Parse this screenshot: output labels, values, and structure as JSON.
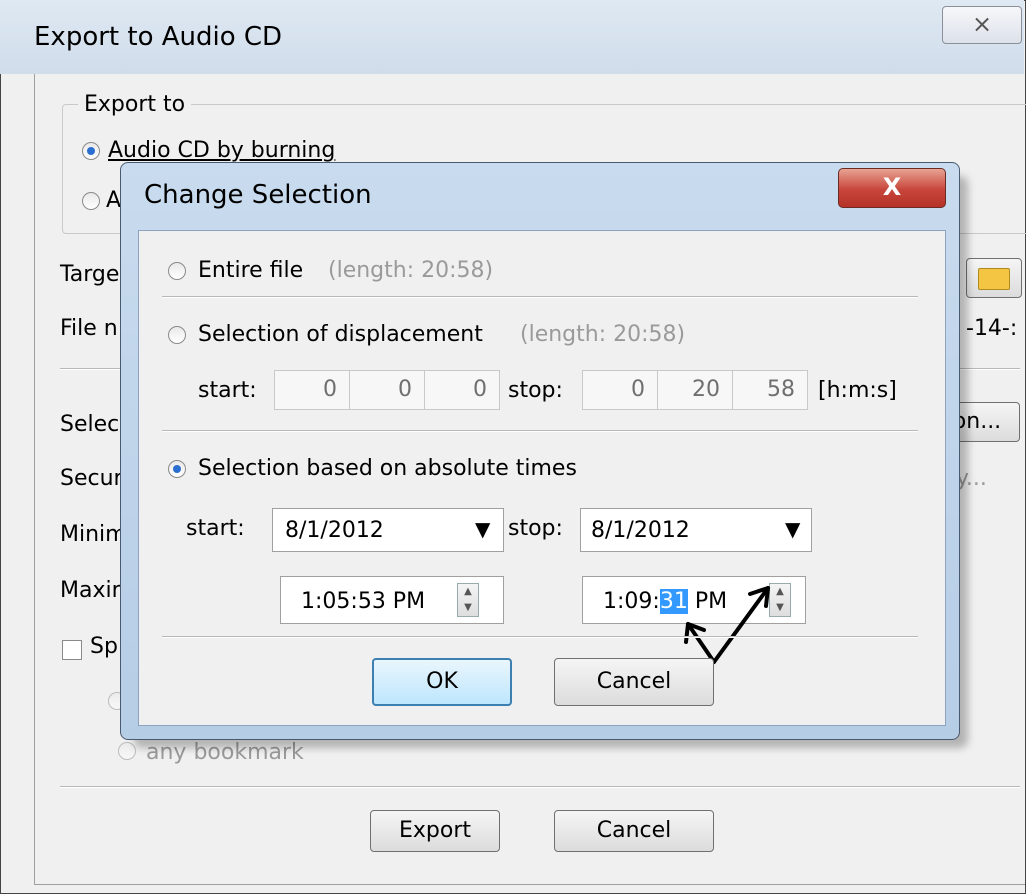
{
  "outer": {
    "title": "Export to Audio CD",
    "close_glyph": "⨯",
    "group_label": "Export to",
    "radio_burn": "Audio CD by burning",
    "radio_second_partial": "A",
    "target_partial": "Targe",
    "filename_partial": "File n",
    "filename_value_partial": "-14-:",
    "selection_partial": "Selec",
    "selection_btn_partial": "on...",
    "security_partial": "Secur",
    "security_btn_partial": "y...",
    "minimum_partial": "Minim",
    "maximum_partial": "Maxin",
    "split_partial": "Sp",
    "any_bookmark": "any bookmark",
    "export_btn": "Export",
    "cancel_btn": "Cancel"
  },
  "inner": {
    "title": "Change Selection",
    "close_glyph": "X",
    "entire_file": "Entire file",
    "entire_length": "(length: 20:58)",
    "selection_disp": "Selection of displacement",
    "selection_disp_length": "(length: 20:58)",
    "start_label": "start:",
    "stop_label": "stop:",
    "start_h": "0",
    "start_m": "0",
    "start_s": "0",
    "stop_h": "0",
    "stop_m": "20",
    "stop_s": "58",
    "units": "[h:m:s]",
    "absolute_label": "Selection based on absolute times",
    "abs_start_label": "start:",
    "abs_stop_label": "stop:",
    "start_date": "8/1/2012",
    "stop_date": "8/1/2012",
    "start_time": "1:05:53 PM",
    "stop_time_prefix": "1:09:",
    "stop_time_selected": "31",
    "stop_time_suffix": " PM",
    "ok_btn": "OK",
    "cancel_btn": "Cancel"
  },
  "colors": {
    "accent": "#3399ff",
    "close_red": "#c7453a"
  }
}
